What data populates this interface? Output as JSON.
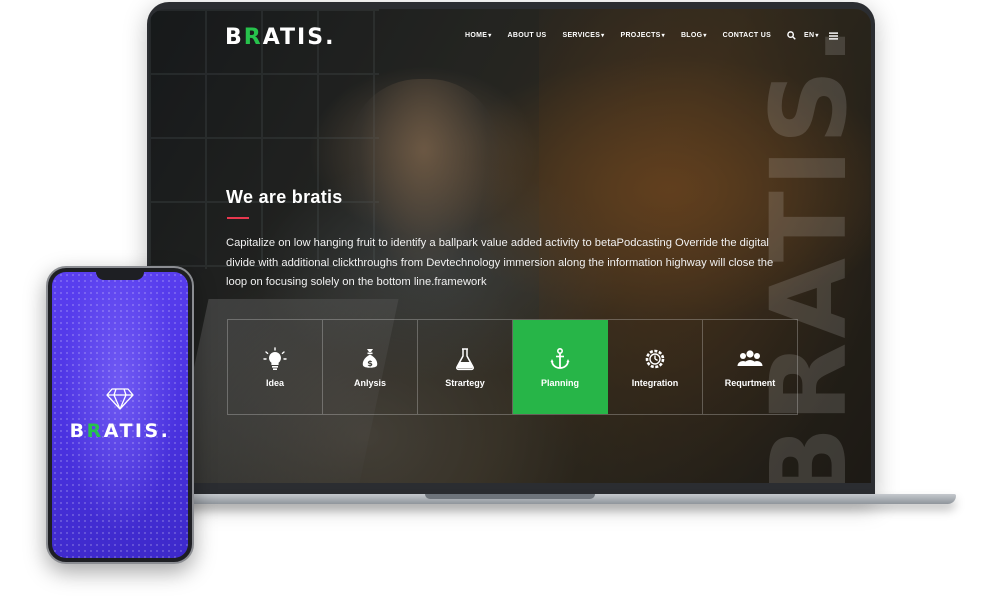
{
  "brand": {
    "logo_first": "B",
    "logo_accent": "R",
    "logo_rest": "ATIS",
    "logo_dot": ".",
    "watermark": "BRATIS.",
    "accent_color": "#27c24c"
  },
  "nav": {
    "items": [
      {
        "label": "HOME",
        "has_dropdown": true
      },
      {
        "label": "ABOUT US",
        "has_dropdown": false
      },
      {
        "label": "SERVICES",
        "has_dropdown": true
      },
      {
        "label": "PROJECTS",
        "has_dropdown": true
      },
      {
        "label": "BLOG",
        "has_dropdown": true
      },
      {
        "label": "CONTACT US",
        "has_dropdown": false
      }
    ],
    "search_icon": "search-icon",
    "language": "EN",
    "menu_icon": "hamburger-icon"
  },
  "hero": {
    "title": "We are bratis",
    "underline_color": "#e8384f",
    "text": "Capitalize on low hanging fruit to identify a ballpark value added activity to betaPodcasting   Override the digital divide with additional clickthroughs from Devtechnology immersion along the information highway will close the loop on focusing solely on the bottom line.framework"
  },
  "features": [
    {
      "label": "Idea",
      "icon": "lightbulb-icon",
      "active": false
    },
    {
      "label": "Anlysis",
      "icon": "money-bag-icon",
      "active": false
    },
    {
      "label": "Strartegy",
      "icon": "flask-icon",
      "active": false
    },
    {
      "label": "Planning",
      "icon": "anchor-icon",
      "active": true
    },
    {
      "label": "Integration",
      "icon": "gear-clock-icon",
      "active": false
    },
    {
      "label": "Requrtment",
      "icon": "users-icon",
      "active": false
    }
  ],
  "feature_active_color": "#27b548",
  "phone": {
    "logo_first": "B",
    "logo_accent": "R",
    "logo_rest": "ATIS",
    "logo_dot": ".",
    "icon": "diamond-icon",
    "background_color": "#4a32e0"
  }
}
